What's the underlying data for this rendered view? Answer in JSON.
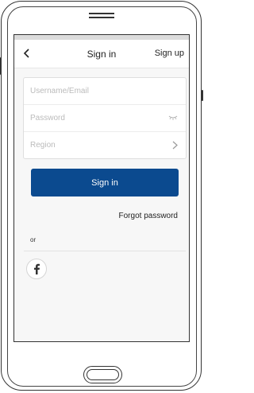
{
  "header": {
    "title": "Sign in",
    "signup_label": "Sign up"
  },
  "form": {
    "username_placeholder": "Username/Email",
    "password_placeholder": "Password",
    "region_placeholder": "Region"
  },
  "actions": {
    "signin_label": "Sign in",
    "forgot_label": "Forgot password",
    "or_label": "or"
  },
  "social": {
    "facebook_icon": "facebook-icon"
  },
  "colors": {
    "primary": "#0b4a8f"
  }
}
